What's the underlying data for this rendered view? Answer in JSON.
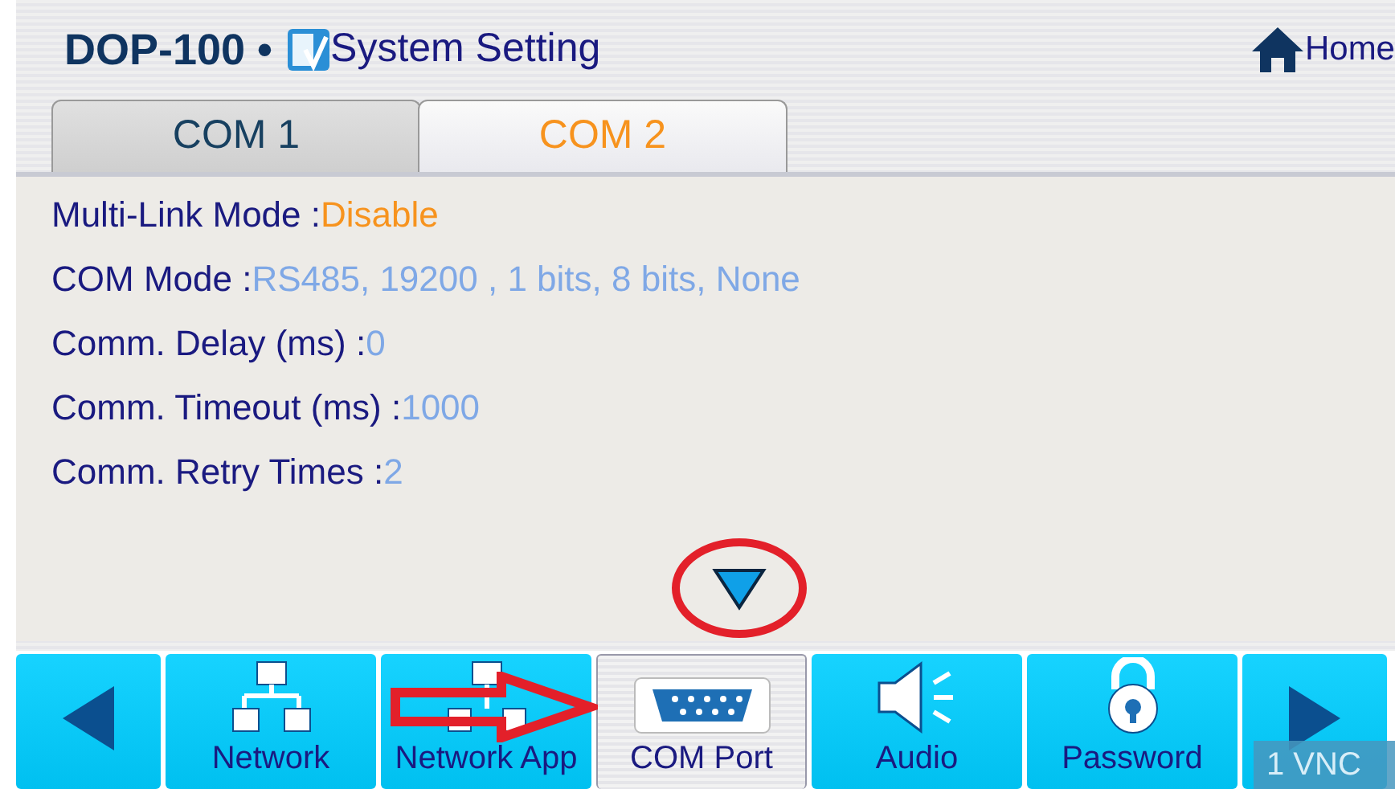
{
  "header": {
    "model": "DOP-100 •",
    "title": "System Setting",
    "home": "Home"
  },
  "tabs": [
    {
      "label": "COM 1",
      "selected": false
    },
    {
      "label": "COM 2",
      "selected": true
    }
  ],
  "settings": [
    {
      "label": "Multi-Link Mode :",
      "value": "Disable",
      "color": "#f7931e"
    },
    {
      "label": "COM Mode :",
      "value": "RS485, 19200  , 1 bits, 8 bits, None",
      "color": "#7fa8e6"
    },
    {
      "label": "Comm. Delay  (ms) :",
      "value": "0",
      "color": "#7fa8e6"
    },
    {
      "label": "Comm. Timeout (ms) :",
      "value": "1000",
      "color": "#7fa8e6"
    },
    {
      "label": "Comm. Retry Times :",
      "value": "2",
      "color": "#7fa8e6"
    }
  ],
  "nav": [
    {
      "kind": "prev",
      "selected": false
    },
    {
      "kind": "network",
      "label": "Network",
      "selected": false
    },
    {
      "kind": "network-app",
      "label": "Network App",
      "selected": false
    },
    {
      "kind": "com",
      "label": "COM Port",
      "selected": true
    },
    {
      "kind": "audio",
      "label": "Audio",
      "selected": false
    },
    {
      "kind": "password",
      "label": "Password",
      "selected": false
    },
    {
      "kind": "next",
      "selected": false
    }
  ],
  "vnc": "1 VNC"
}
